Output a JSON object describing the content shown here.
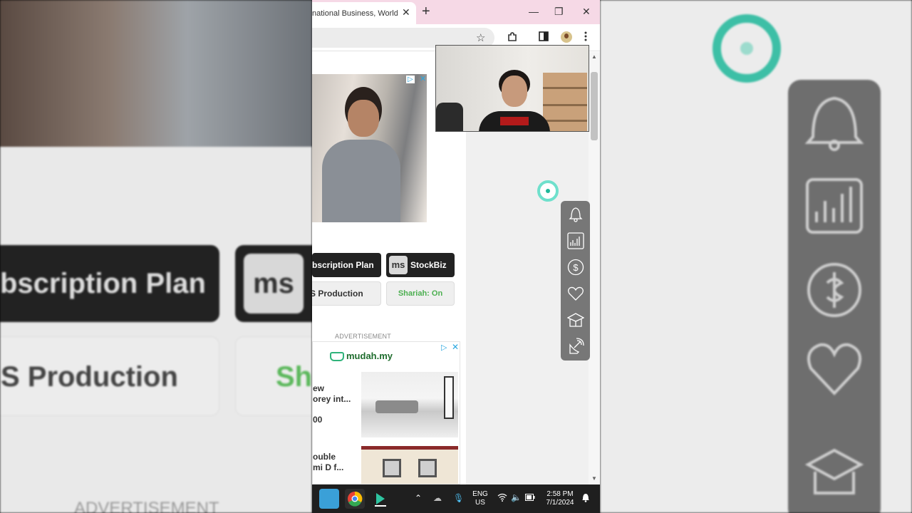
{
  "browser": {
    "tab_title": "national Business, World N",
    "tab_close": "✕",
    "new_tab": "+",
    "window_controls": {
      "minimize": "—",
      "restore": "❐",
      "close": "✕"
    }
  },
  "toolbar": {
    "icons": [
      "star-icon",
      "extensions-icon",
      "side-panel-icon",
      "profile-avatar",
      "menu-icon"
    ]
  },
  "page": {
    "buttons": {
      "subscription_plan": "bscription Plan",
      "ms_logo": "ms",
      "stockbiz": "StockBiz",
      "production": "S Production",
      "shariah": "Shariah: On"
    },
    "advertisement_label": "ADVERTISEMENT",
    "ad2": {
      "brand": "mudah.my",
      "listing1": {
        "line1": "ew",
        "line2": "orey int...",
        "price": "00"
      },
      "listing2": {
        "line1": "ouble",
        "line2": "mi D f..."
      }
    }
  },
  "background": {
    "left_subscription": "bscription Plan",
    "left_ms": "ms",
    "left_production": "S Production",
    "left_shariah": "Sha",
    "left_advertisement": "ADVERTISEMENT"
  },
  "float_panel": {
    "icons": [
      "bell-icon",
      "chart-icon",
      "dollar-icon",
      "heart-icon",
      "education-icon",
      "satellite-icon"
    ]
  },
  "taskbar": {
    "lang_top": "ENG",
    "lang_bottom": "US",
    "time": "2:58 PM",
    "date": "7/1/2024",
    "colors": {
      "accent": "#1fb89a",
      "shariah": "#4caf50"
    }
  }
}
